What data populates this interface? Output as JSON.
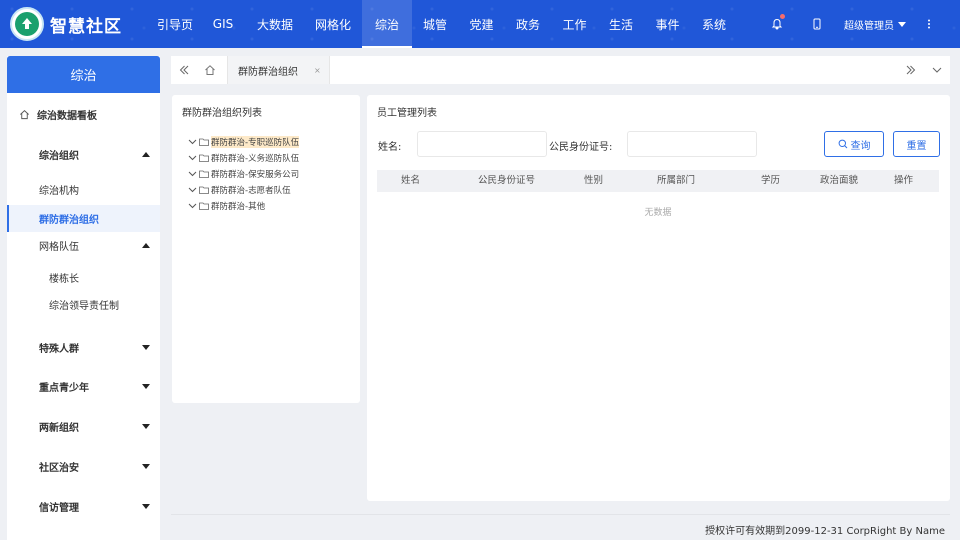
{
  "app": {
    "title": "智慧社区",
    "logo_text": "智慧社区"
  },
  "nav": {
    "items": [
      {
        "label": "引导页",
        "active": false
      },
      {
        "label": "GIS",
        "active": false
      },
      {
        "label": "大数据",
        "active": false
      },
      {
        "label": "网格化",
        "active": false
      },
      {
        "label": "综治",
        "active": true
      },
      {
        "label": "城管",
        "active": false
      },
      {
        "label": "党建",
        "active": false
      },
      {
        "label": "政务",
        "active": false
      },
      {
        "label": "工作",
        "active": false
      },
      {
        "label": "生活",
        "active": false
      },
      {
        "label": "事件",
        "active": false
      },
      {
        "label": "系统",
        "active": false
      }
    ]
  },
  "header": {
    "user": "超级管理员",
    "icons": [
      "bell-icon",
      "phone-icon",
      "more-vertical-icon"
    ],
    "notification_color": "#f56c6c"
  },
  "sidebar": {
    "title": "综治",
    "items": [
      {
        "label": "综治数据看板",
        "icon": "home-icon"
      },
      {
        "label": "综治组织",
        "toggle": "up"
      },
      {
        "label": "综治机构"
      },
      {
        "label": "群防群治组织",
        "active": true
      },
      {
        "label": "网格队伍",
        "toggle": "up"
      },
      {
        "label": "楼栋长"
      },
      {
        "label": "综治领导责任制"
      },
      {
        "label": "特殊人群",
        "toggle": "down"
      },
      {
        "label": "重点青少年",
        "toggle": "down"
      },
      {
        "label": "两新组织",
        "toggle": "down"
      },
      {
        "label": "社区治安",
        "toggle": "down"
      },
      {
        "label": "信访管理",
        "toggle": "down"
      }
    ]
  },
  "tabs": {
    "items": [
      {
        "label": "群防群治组织",
        "close": "×"
      }
    ]
  },
  "tree_panel": {
    "title": "群防群治组织列表",
    "nodes": [
      {
        "label": "群防群治-专职巡防队伍",
        "selected": true
      },
      {
        "label": "群防群治-义务巡防队伍"
      },
      {
        "label": "群防群治-保安服务公司"
      },
      {
        "label": "群防群治-志愿者队伍"
      },
      {
        "label": "群防群治-其他"
      }
    ]
  },
  "staff_panel": {
    "title": "员工管理列表",
    "name_label": "姓名:",
    "id_label": "公民身份证号:",
    "name_value": "",
    "id_value": "",
    "search_button": "查询",
    "reset_button": "重置",
    "columns": [
      "姓名",
      "公民身份证号",
      "性别",
      "所属部门",
      "学历",
      "政治面貌",
      "操作"
    ],
    "empty_text": "无数据"
  },
  "footer": {
    "text": "授权许可有效期到2099-12-31 CorpRight By Name"
  },
  "colors": {
    "header_bg": "#2057d8",
    "accent": "#2f6fe6",
    "selected_node": "#fde9c8"
  }
}
